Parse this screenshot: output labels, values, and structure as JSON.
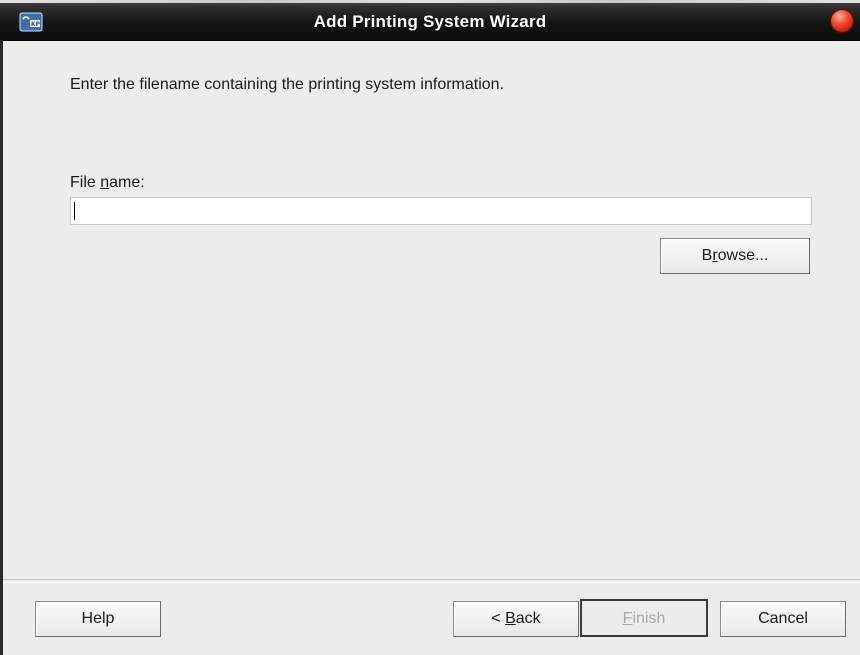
{
  "window": {
    "title": "Add Printing System Wizard"
  },
  "content": {
    "instruction": "Enter the filename containing the printing system information.",
    "file_label_prefix": "File ",
    "file_label_mnemonic": "n",
    "file_label_suffix": "ame:",
    "file_input_value": "",
    "browse_pre": "B",
    "browse_mnemonic": "r",
    "browse_post": "owse..."
  },
  "buttons": {
    "help": "Help",
    "back_pre": "< ",
    "back_mnemonic": "B",
    "back_post": "ack",
    "finish_mnemonic": "F",
    "finish_post": "inish",
    "cancel": "Cancel"
  },
  "icons": {
    "app": "printer-wizard-icon",
    "close": "close-icon"
  },
  "colors": {
    "titlebar": "#1a1a1a",
    "title_text": "#ffffff",
    "close_button": "#e03a1e",
    "background": "#ececec"
  }
}
